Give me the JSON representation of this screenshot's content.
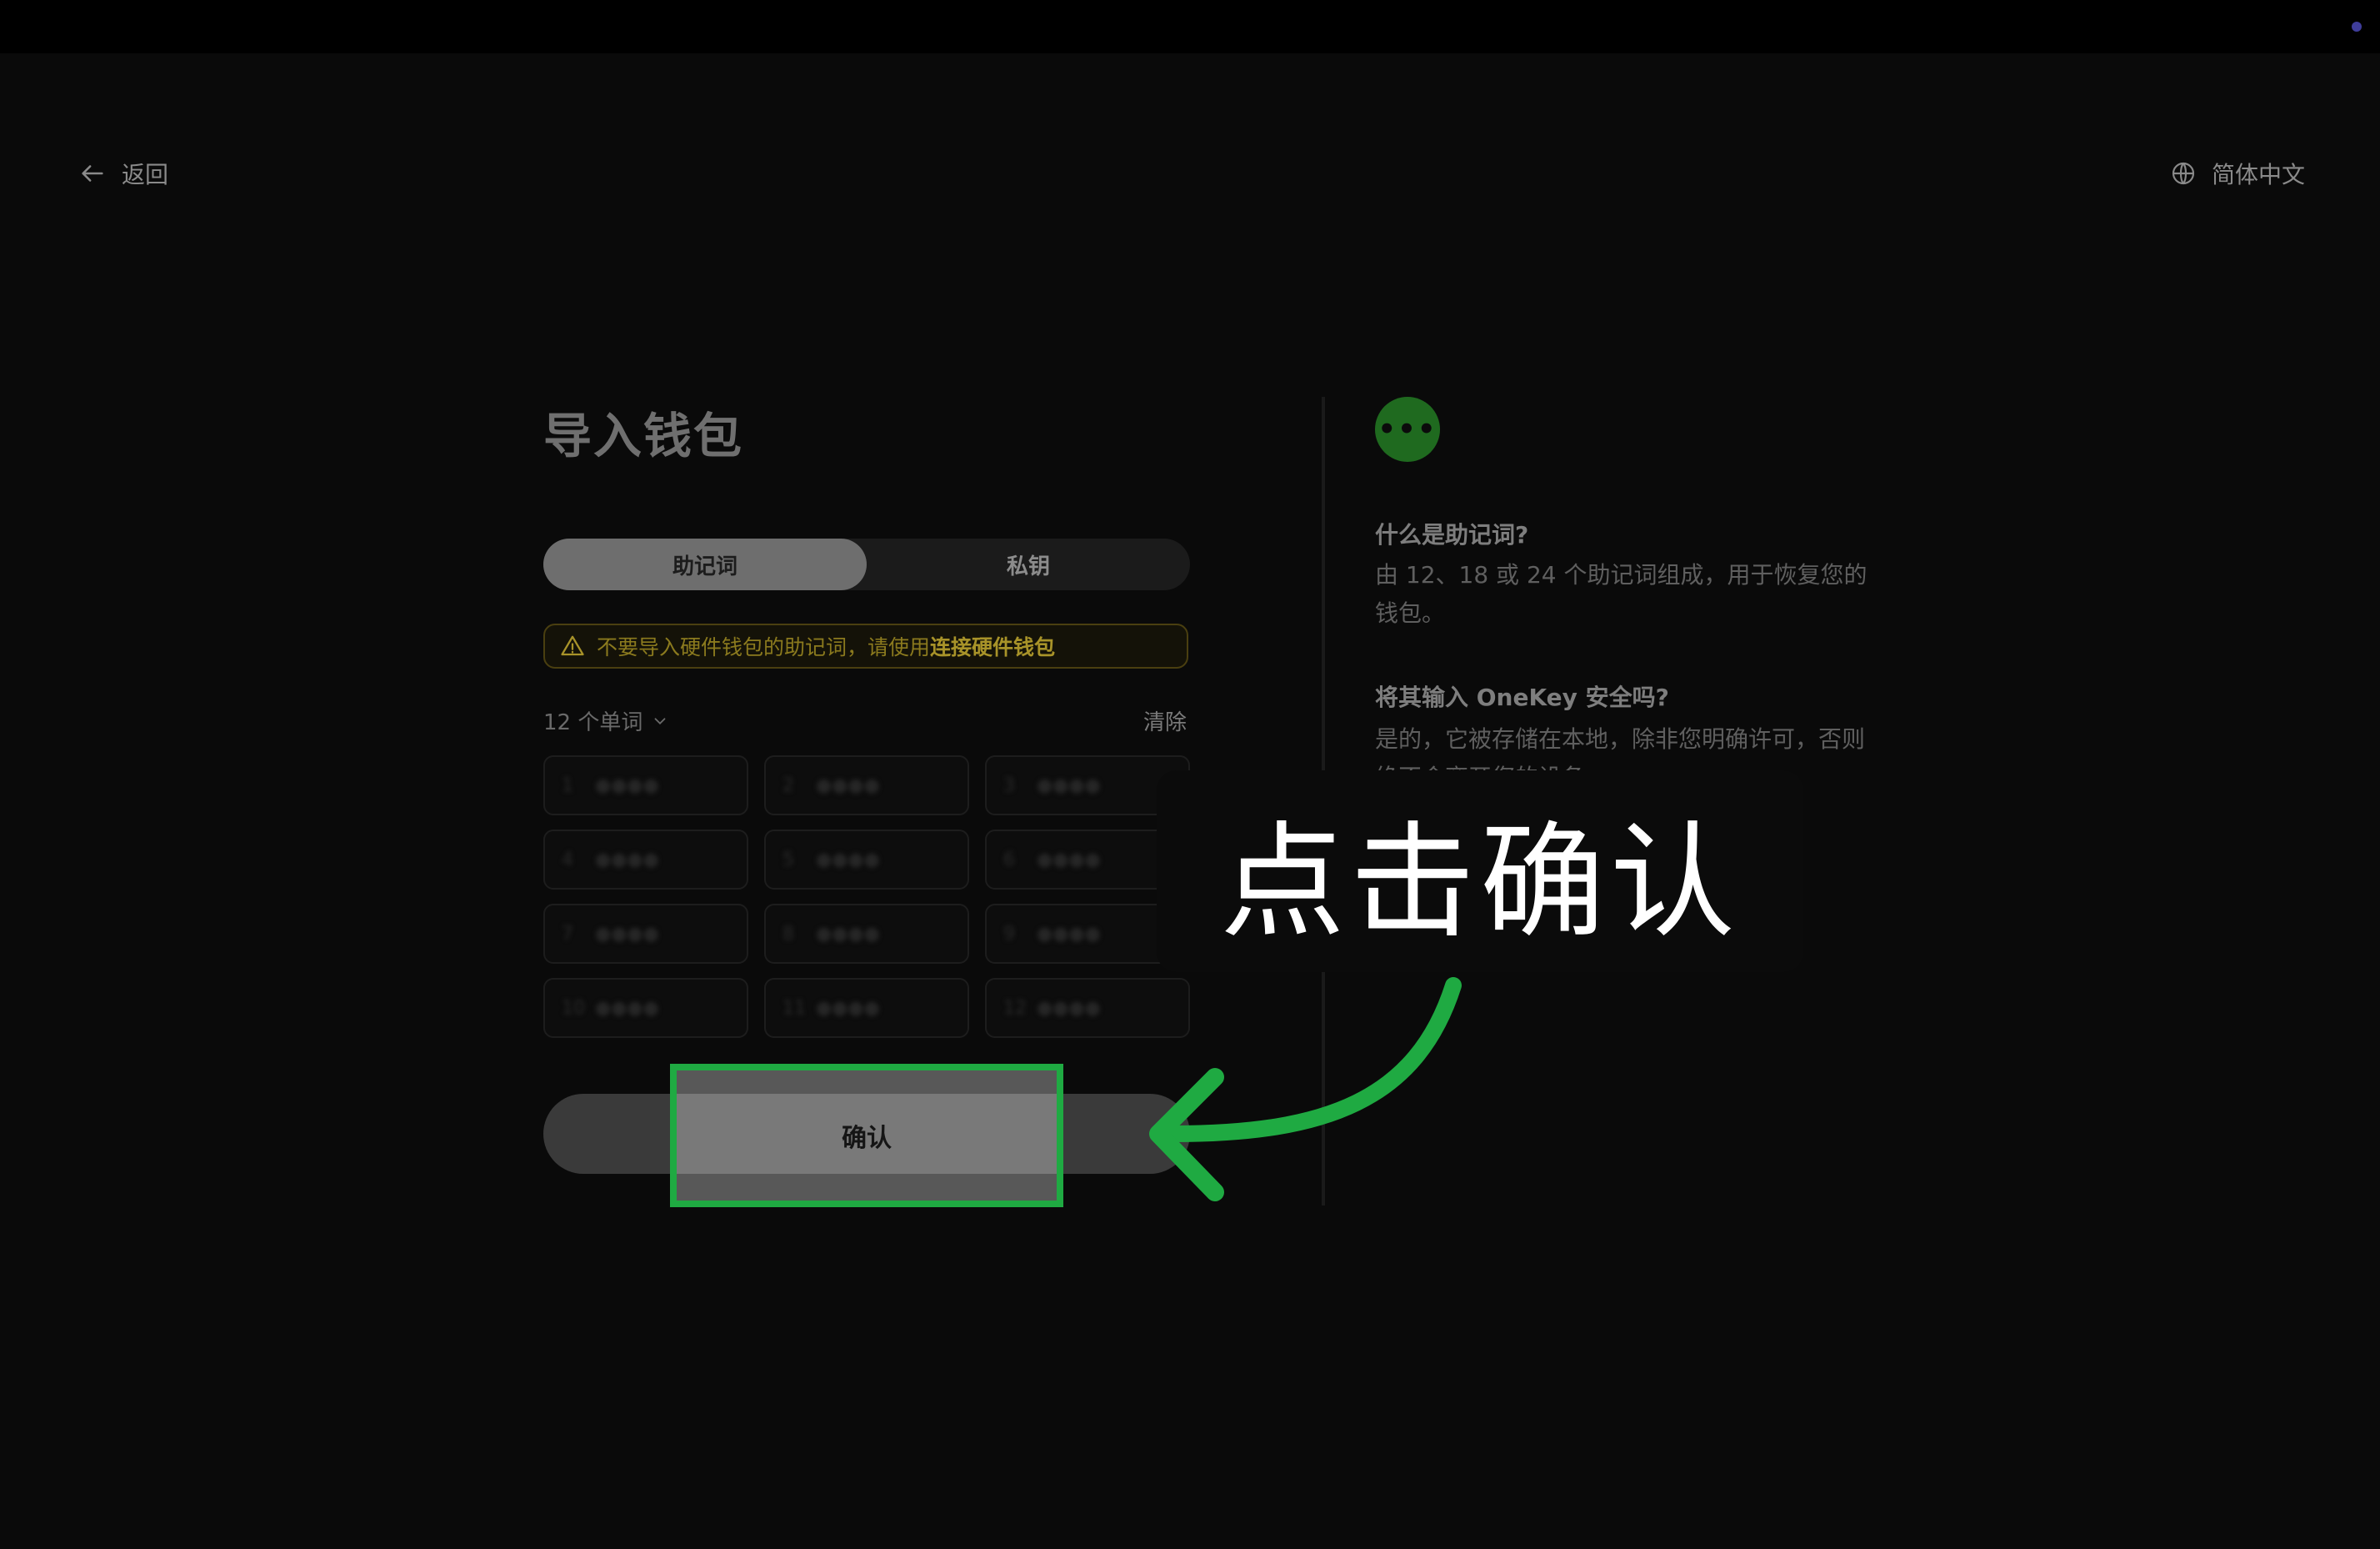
{
  "header": {
    "back_label": "返回",
    "language": "简体中文"
  },
  "page": {
    "title": "导入钱包"
  },
  "tabs": [
    {
      "label": "助记词",
      "active": true
    },
    {
      "label": "私钥",
      "active": false
    }
  ],
  "warning": {
    "text": "不要导入硬件钱包的助记词，请使用",
    "link": "连接硬件钱包"
  },
  "words": {
    "count_label": "12 个单词",
    "clear_label": "清除",
    "cells": [
      {
        "num": "1",
        "placeholder": "●●●●"
      },
      {
        "num": "2",
        "placeholder": "●●●●"
      },
      {
        "num": "3",
        "placeholder": "●●●●"
      },
      {
        "num": "4",
        "placeholder": "●●●●"
      },
      {
        "num": "5",
        "placeholder": "●●●●"
      },
      {
        "num": "6",
        "placeholder": "●●●●"
      },
      {
        "num": "7",
        "placeholder": "●●●●"
      },
      {
        "num": "8",
        "placeholder": "●●●●"
      },
      {
        "num": "9",
        "placeholder": "●●●●"
      },
      {
        "num": "10",
        "placeholder": "●●●●"
      },
      {
        "num": "11",
        "placeholder": "●●●●"
      },
      {
        "num": "12",
        "placeholder": "●●●●"
      }
    ]
  },
  "confirm_label": "确认",
  "help": {
    "badge": "•••",
    "q1": "什么是助记词?",
    "a1": "由 12、18 或 24 个助记词组成，用于恢复您的钱包。",
    "q2": "将其输入 OneKey 安全吗?",
    "a2": "是的，它被存储在本地，除非您明确许可，否则绝不会离开您的设备。"
  },
  "annotation": {
    "callout": "点击确认",
    "color": "#1faa42"
  },
  "colors": {
    "accent_green": "#1faa42",
    "warning": "#a89329",
    "background": "#0a0a0a"
  }
}
